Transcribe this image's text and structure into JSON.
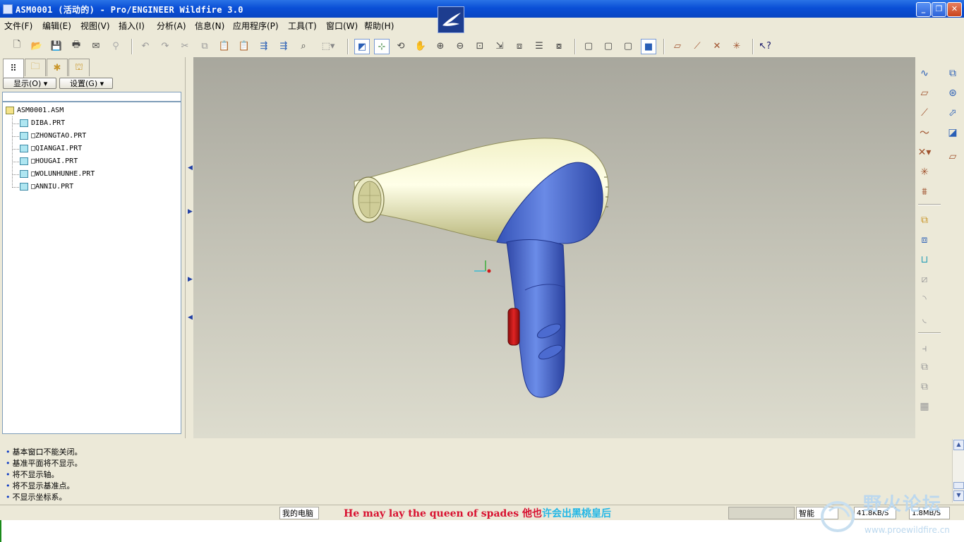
{
  "window": {
    "title": "ASM0001 (活动的) - Pro/ENGINEER Wildfire 3.0",
    "minimize": "_",
    "restore": "❐",
    "close": "✕"
  },
  "menu": [
    "文件(F)",
    "编辑(E)",
    "视图(V)",
    "插入(I)",
    "分析(A)",
    "信息(N)",
    "应用程序(P)",
    "工具(T)",
    "窗口(W)",
    "帮助(H)"
  ],
  "panel": {
    "show_label": "显示(O)",
    "settings_label": "设置(G)"
  },
  "tree": {
    "root": "ASM0001.ASM",
    "items": [
      "DIBA.PRT",
      "□ZHONGTAO.PRT",
      "□QIANGAI.PRT",
      "□HOUGAI.PRT",
      "□WOLUNHUNHE.PRT",
      "□ANNIU.PRT"
    ]
  },
  "messages": [
    "基本窗口不能关闭。",
    "基准平面将不显示。",
    "将不显示轴。",
    "将不显示基准点。",
    "不显示坐标系。"
  ],
  "status": {
    "computer": "我的电脑",
    "subtitle_en": "He may lay the queen of spades 他也",
    "subtitle_zh": "许会出黑桃皇后",
    "mode": "智能",
    "download": "41.8KB/S",
    "upload": "1.8MB/S"
  },
  "watermark": {
    "title": "野火论坛",
    "url": "www.proewildfire.cn"
  },
  "colors": {
    "titlebar": "#0a4fd6",
    "body_blue": "#4a6ed6",
    "body_cream": "#e8e7b4",
    "button_red": "#c41a1a"
  }
}
